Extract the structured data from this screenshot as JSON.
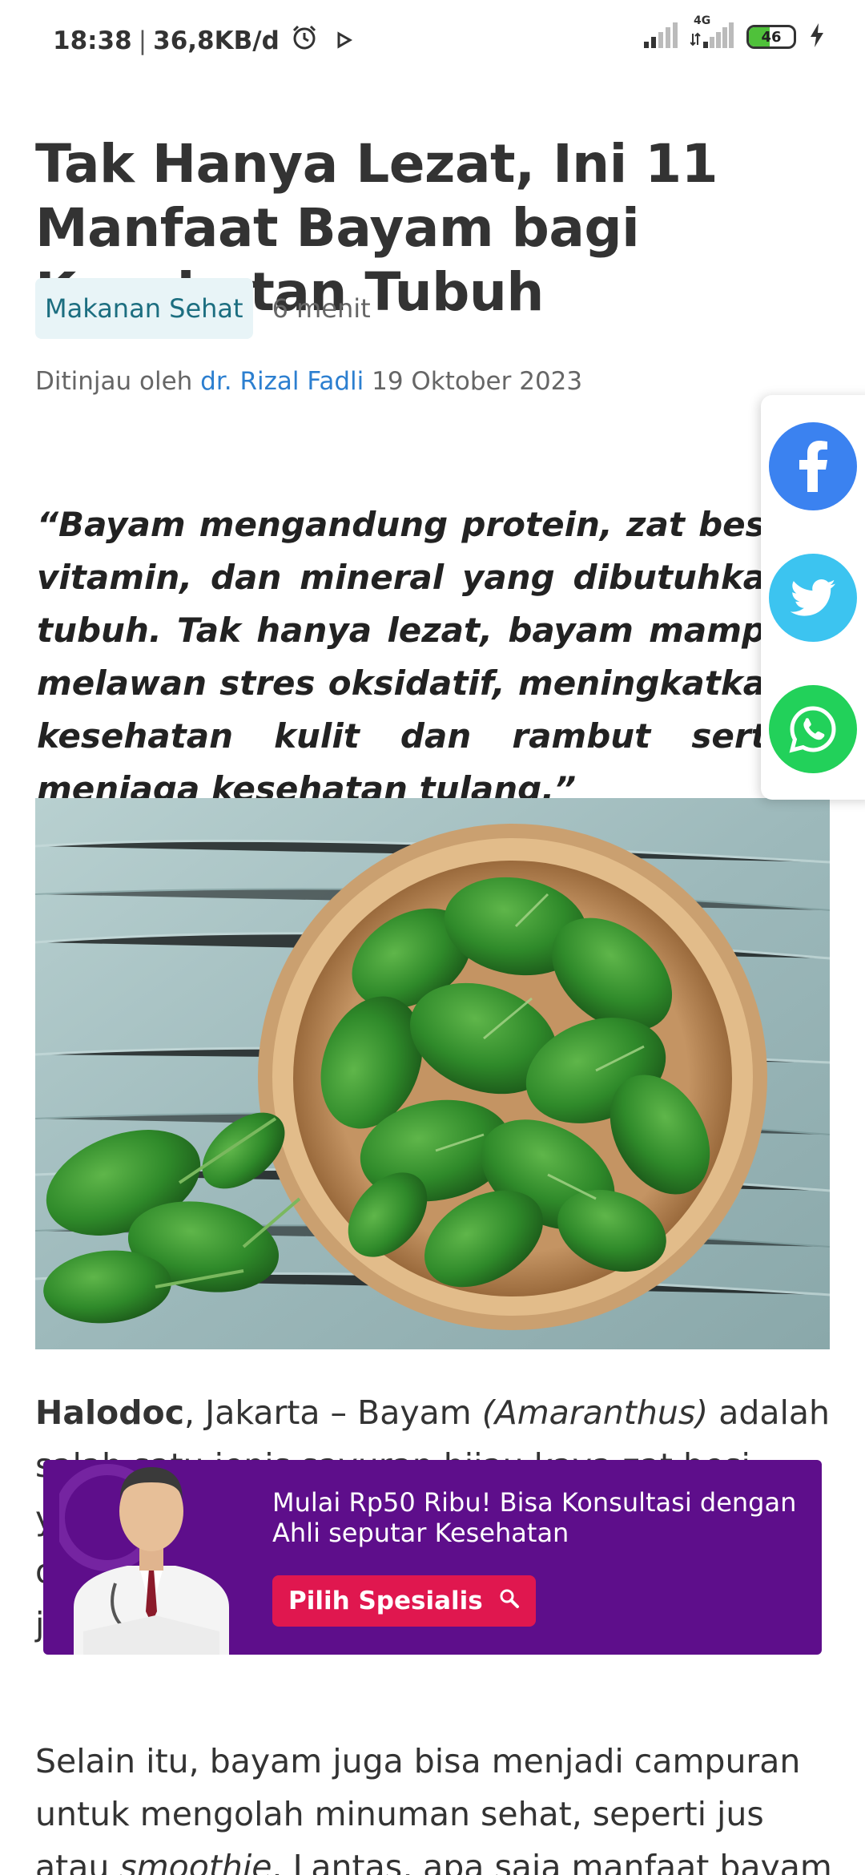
{
  "status_bar": {
    "time": "18:38",
    "data_speed": "36,8KB/d",
    "network_label": "4G",
    "battery_level": "46"
  },
  "article": {
    "title": "Tak Hanya Lezat, Ini 11 Manfaat Bayam bagi Kesehatan Tubuh",
    "category": "Makanan Sehat",
    "read_time": "6 menit",
    "reviewed_prefix": "Ditinjau oleh",
    "reviewer": "dr. Rizal Fadli",
    "date": "19 Oktober 2023",
    "quote": "“Bayam mengandung protein, zat besi, vitamin, dan mineral yang dibutuhkan tubuh. Tak hanya lezat, bayam mampu melawan stres oksidatif, meningkatkan kesehatan kulit dan rambut serta menjaga kesehatan tulang.”",
    "p1_brand": "Halodoc",
    "p1_a": ", Jakarta – Bayam ",
    "p1_latin": "(Amaranthus)",
    "p1_b": " adalah salah satu jenis sayuran hijau kaya zat besi yang populer di Indonesia. Sayuran ini mudah diolah dan sering disajikan menjadi berbagai jenis hidangan.",
    "p2_a": "Selain itu, bayam juga bisa menjadi campuran untuk mengolah minuman sehat, seperti jus atau ",
    "p2_italic": "smoothie",
    "p2_b": ". Lantas, apa saja manfaat bayam"
  },
  "share": {
    "facebook": "facebook-icon",
    "twitter": "twitter-icon",
    "whatsapp": "whatsapp-icon"
  },
  "promo": {
    "text": "Mulai Rp50 Ribu! Bisa Konsultasi dengan Ahli seputar Kesehatan",
    "button_label": "Pilih Spesialis"
  },
  "colors": {
    "accent_link": "#2c7fd0",
    "promo_bg": "#5e0e8b",
    "promo_button": "#e0174f",
    "category_bg": "#e8f4f7"
  }
}
